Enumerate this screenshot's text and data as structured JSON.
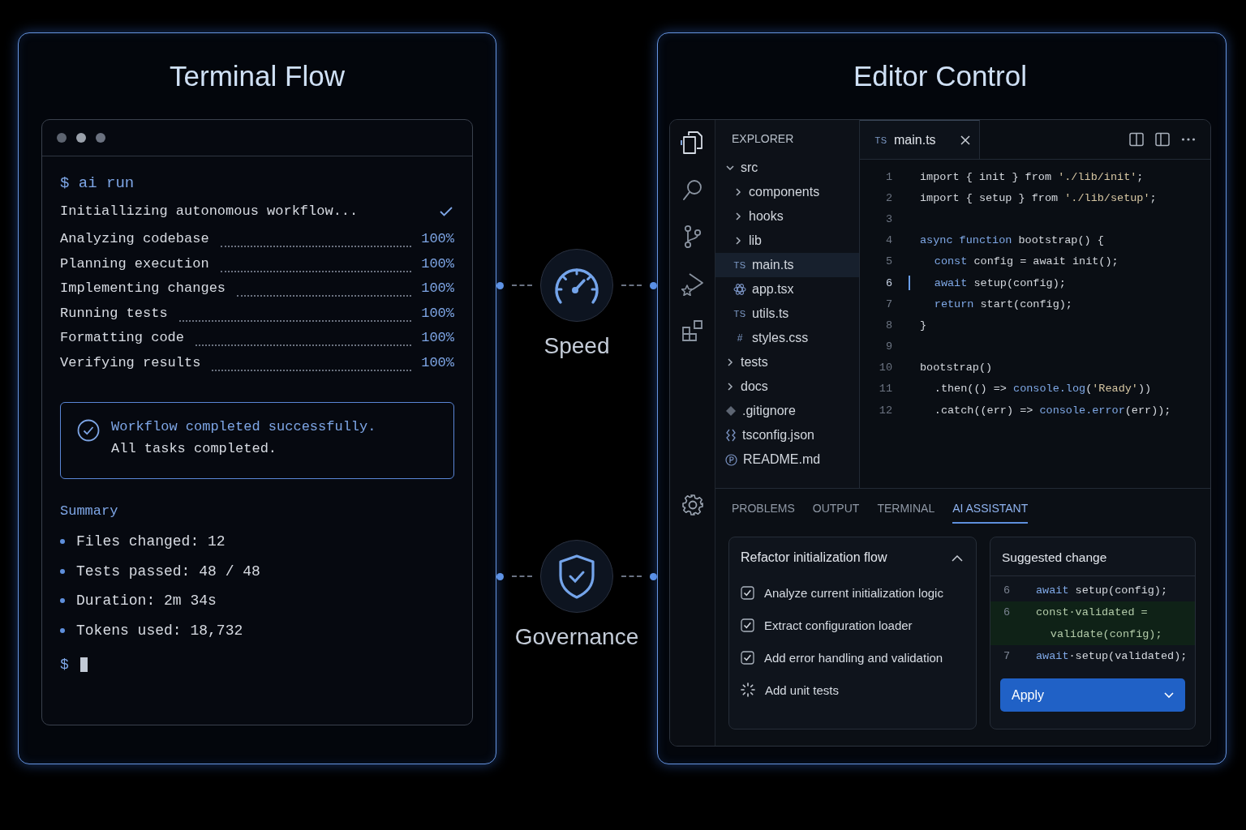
{
  "terminal_panel": {
    "title": "Terminal Flow",
    "prompt": "$ ai run",
    "init_line": {
      "text": "Initiallizing autonomous workflow...",
      "done": true
    },
    "steps": [
      {
        "label": "Analyzing codebase",
        "percent": "100%"
      },
      {
        "label": "Planning execution",
        "percent": "100%"
      },
      {
        "label": "Implementing changes",
        "percent": "100%"
      },
      {
        "label": "Running tests",
        "percent": "100%"
      },
      {
        "label": "Formatting code",
        "percent": "100%"
      },
      {
        "label": "Verifying results",
        "percent": "100%"
      }
    ],
    "result": {
      "title": "Workflow completed successfully.",
      "subtitle": "All tasks completed."
    },
    "summary": {
      "title": "Summary",
      "items": [
        "Files changed: 12",
        "Tests passed: 48 / 48",
        "Duration: 2m 34s",
        "Tokens used: 18,732"
      ]
    },
    "cursor_prompt": "$"
  },
  "features": [
    {
      "label": "Speed",
      "kind": "speed"
    },
    {
      "label": "Governance",
      "kind": "governance"
    }
  ],
  "editor_panel": {
    "title": "Editor Control",
    "activity_bar": [
      {
        "kind": "files",
        "selected": true
      },
      {
        "kind": "search",
        "selected": false
      },
      {
        "kind": "source-control",
        "selected": false
      },
      {
        "kind": "run",
        "selected": false
      },
      {
        "kind": "extensions",
        "selected": false
      }
    ],
    "explorer": {
      "title": "EXPLORER",
      "tree": [
        {
          "name": "src",
          "kind": "folder",
          "expanded": true,
          "selected": false,
          "children": [
            {
              "name": "components",
              "kind": "folder",
              "expanded": false,
              "selected": false
            },
            {
              "name": "hooks",
              "kind": "folder",
              "expanded": false,
              "selected": false
            },
            {
              "name": "lib",
              "kind": "folder",
              "expanded": false,
              "selected": false
            },
            {
              "name": "main.ts",
              "kind": "file",
              "badge": "TS",
              "selected": true
            },
            {
              "name": "app.tsx",
              "kind": "react",
              "selected": false
            },
            {
              "name": "utils.ts",
              "kind": "file",
              "badge": "TS",
              "selected": false
            },
            {
              "name": "styles.css",
              "kind": "file",
              "badge": "#",
              "selected": false
            }
          ]
        },
        {
          "name": "tests",
          "kind": "folder",
          "expanded": false,
          "selected": false
        },
        {
          "name": "docs",
          "kind": "folder",
          "expanded": false,
          "selected": false
        },
        {
          "name": ".gitignore",
          "kind": "git",
          "selected": false
        },
        {
          "name": "tsconfig.json",
          "kind": "config",
          "selected": false
        },
        {
          "name": "README.md",
          "kind": "info",
          "selected": false
        }
      ]
    },
    "tab": {
      "badge": "TS",
      "name": "main.ts"
    },
    "code": [
      {
        "number": "1",
        "current": false,
        "tokens": [
          {
            "text": "import { init } from ",
            "kind": "plain"
          },
          {
            "text": "'./lib/init'",
            "kind": "string"
          },
          {
            "text": ";",
            "kind": "plain"
          }
        ]
      },
      {
        "number": "2",
        "current": false,
        "tokens": [
          {
            "text": "import { setup } from ",
            "kind": "plain"
          },
          {
            "text": "'./lib/setup'",
            "kind": "string"
          },
          {
            "text": ";",
            "kind": "plain"
          }
        ]
      },
      {
        "number": "3",
        "current": false
      },
      {
        "number": "4",
        "current": false,
        "tokens": [
          {
            "text": "async function",
            "kind": "keyword"
          },
          {
            "text": " bootstrap() {",
            "kind": "plain"
          }
        ]
      },
      {
        "number": "5",
        "current": false,
        "indented": true,
        "tokens": [
          {
            "text": "const",
            "kind": "keyword"
          },
          {
            "text": " config = await init();",
            "kind": "plain"
          }
        ]
      },
      {
        "number": "6",
        "current": true,
        "indented": true,
        "tokens": [
          {
            "text": "await",
            "kind": "keyword"
          },
          {
            "text": " setup(config);",
            "kind": "plain"
          }
        ]
      },
      {
        "number": "7",
        "current": false,
        "indented": true,
        "tokens": [
          {
            "text": "return",
            "kind": "keyword"
          },
          {
            "text": " start(config);",
            "kind": "plain"
          }
        ]
      },
      {
        "number": "8",
        "current": false,
        "tokens": [
          {
            "text": "}",
            "kind": "plain"
          }
        ]
      },
      {
        "number": "9",
        "current": false
      },
      {
        "number": "10",
        "current": false,
        "tokens": [
          {
            "text": "bootstrap()",
            "kind": "plain"
          }
        ]
      },
      {
        "number": "11",
        "current": false,
        "indented": true,
        "tokens": [
          {
            "text": ".then(() => ",
            "kind": "plain"
          },
          {
            "text": "console.log",
            "kind": "keyword"
          },
          {
            "text": "(",
            "kind": "plain"
          },
          {
            "text": "'Ready'",
            "kind": "string"
          },
          {
            "text": "))",
            "kind": "plain"
          }
        ]
      },
      {
        "number": "12",
        "current": false,
        "indented": true,
        "tokens": [
          {
            "text": ".catch((err) => ",
            "kind": "plain"
          },
          {
            "text": "console.error",
            "kind": "keyword"
          },
          {
            "text": "(err));",
            "kind": "plain"
          }
        ]
      }
    ],
    "panel_tabs": [
      {
        "label": "PROBLEMS",
        "selected": false
      },
      {
        "label": "OUTPUT",
        "selected": false
      },
      {
        "label": "TERMINAL",
        "selected": false
      },
      {
        "label": "AI ASSISTANT",
        "selected": true
      }
    ],
    "plan": {
      "title": "Refactor initialization flow",
      "expanded": true,
      "tasks": [
        {
          "label": "Analyze current initialization logic",
          "kind": "done"
        },
        {
          "label": "Extract configuration loader",
          "kind": "done"
        },
        {
          "label": "Add error handling and validation",
          "kind": "done"
        },
        {
          "label": "Add unit tests",
          "kind": "running"
        }
      ]
    },
    "suggestion": {
      "title": "Suggested change",
      "lines": [
        {
          "number": "6",
          "kind": "context",
          "tokens": [
            {
              "text": "await",
              "kind": "keyword"
            },
            {
              "text": " setup(config);",
              "kind": "plain"
            }
          ]
        },
        {
          "number": "6",
          "kind": "added",
          "tokens": [
            {
              "text": "const·validated =",
              "kind": "plain"
            }
          ]
        },
        {
          "kind": "added",
          "indented": true,
          "tokens": [
            {
              "text": "validate(config);",
              "kind": "plain"
            }
          ]
        },
        {
          "number": "7",
          "kind": "context",
          "tokens": [
            {
              "text": "await",
              "kind": "keyword"
            },
            {
              "text": "·setup(validated);",
              "kind": "plain"
            }
          ]
        }
      ],
      "button": "Apply"
    }
  }
}
